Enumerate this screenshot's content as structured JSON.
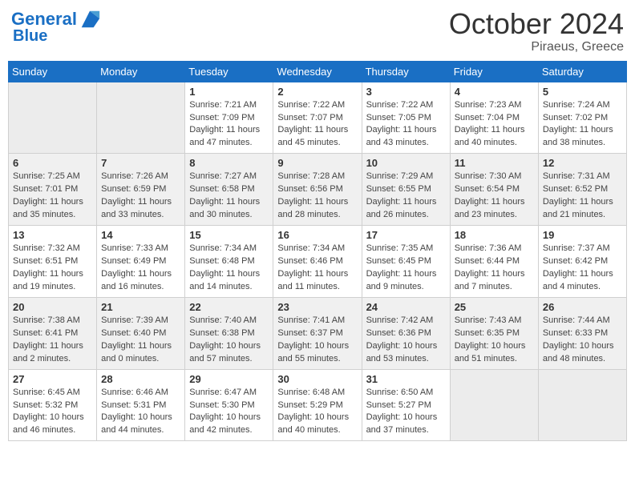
{
  "header": {
    "logo_line1": "General",
    "logo_line2": "Blue",
    "month": "October 2024",
    "location": "Piraeus, Greece"
  },
  "weekdays": [
    "Sunday",
    "Monday",
    "Tuesday",
    "Wednesday",
    "Thursday",
    "Friday",
    "Saturday"
  ],
  "weeks": [
    [
      {
        "day": null
      },
      {
        "day": null
      },
      {
        "day": "1",
        "sunrise": "Sunrise: 7:21 AM",
        "sunset": "Sunset: 7:09 PM",
        "daylight": "Daylight: 11 hours and 47 minutes."
      },
      {
        "day": "2",
        "sunrise": "Sunrise: 7:22 AM",
        "sunset": "Sunset: 7:07 PM",
        "daylight": "Daylight: 11 hours and 45 minutes."
      },
      {
        "day": "3",
        "sunrise": "Sunrise: 7:22 AM",
        "sunset": "Sunset: 7:05 PM",
        "daylight": "Daylight: 11 hours and 43 minutes."
      },
      {
        "day": "4",
        "sunrise": "Sunrise: 7:23 AM",
        "sunset": "Sunset: 7:04 PM",
        "daylight": "Daylight: 11 hours and 40 minutes."
      },
      {
        "day": "5",
        "sunrise": "Sunrise: 7:24 AM",
        "sunset": "Sunset: 7:02 PM",
        "daylight": "Daylight: 11 hours and 38 minutes."
      }
    ],
    [
      {
        "day": "6",
        "sunrise": "Sunrise: 7:25 AM",
        "sunset": "Sunset: 7:01 PM",
        "daylight": "Daylight: 11 hours and 35 minutes."
      },
      {
        "day": "7",
        "sunrise": "Sunrise: 7:26 AM",
        "sunset": "Sunset: 6:59 PM",
        "daylight": "Daylight: 11 hours and 33 minutes."
      },
      {
        "day": "8",
        "sunrise": "Sunrise: 7:27 AM",
        "sunset": "Sunset: 6:58 PM",
        "daylight": "Daylight: 11 hours and 30 minutes."
      },
      {
        "day": "9",
        "sunrise": "Sunrise: 7:28 AM",
        "sunset": "Sunset: 6:56 PM",
        "daylight": "Daylight: 11 hours and 28 minutes."
      },
      {
        "day": "10",
        "sunrise": "Sunrise: 7:29 AM",
        "sunset": "Sunset: 6:55 PM",
        "daylight": "Daylight: 11 hours and 26 minutes."
      },
      {
        "day": "11",
        "sunrise": "Sunrise: 7:30 AM",
        "sunset": "Sunset: 6:54 PM",
        "daylight": "Daylight: 11 hours and 23 minutes."
      },
      {
        "day": "12",
        "sunrise": "Sunrise: 7:31 AM",
        "sunset": "Sunset: 6:52 PM",
        "daylight": "Daylight: 11 hours and 21 minutes."
      }
    ],
    [
      {
        "day": "13",
        "sunrise": "Sunrise: 7:32 AM",
        "sunset": "Sunset: 6:51 PM",
        "daylight": "Daylight: 11 hours and 19 minutes."
      },
      {
        "day": "14",
        "sunrise": "Sunrise: 7:33 AM",
        "sunset": "Sunset: 6:49 PM",
        "daylight": "Daylight: 11 hours and 16 minutes."
      },
      {
        "day": "15",
        "sunrise": "Sunrise: 7:34 AM",
        "sunset": "Sunset: 6:48 PM",
        "daylight": "Daylight: 11 hours and 14 minutes."
      },
      {
        "day": "16",
        "sunrise": "Sunrise: 7:34 AM",
        "sunset": "Sunset: 6:46 PM",
        "daylight": "Daylight: 11 hours and 11 minutes."
      },
      {
        "day": "17",
        "sunrise": "Sunrise: 7:35 AM",
        "sunset": "Sunset: 6:45 PM",
        "daylight": "Daylight: 11 hours and 9 minutes."
      },
      {
        "day": "18",
        "sunrise": "Sunrise: 7:36 AM",
        "sunset": "Sunset: 6:44 PM",
        "daylight": "Daylight: 11 hours and 7 minutes."
      },
      {
        "day": "19",
        "sunrise": "Sunrise: 7:37 AM",
        "sunset": "Sunset: 6:42 PM",
        "daylight": "Daylight: 11 hours and 4 minutes."
      }
    ],
    [
      {
        "day": "20",
        "sunrise": "Sunrise: 7:38 AM",
        "sunset": "Sunset: 6:41 PM",
        "daylight": "Daylight: 11 hours and 2 minutes."
      },
      {
        "day": "21",
        "sunrise": "Sunrise: 7:39 AM",
        "sunset": "Sunset: 6:40 PM",
        "daylight": "Daylight: 11 hours and 0 minutes."
      },
      {
        "day": "22",
        "sunrise": "Sunrise: 7:40 AM",
        "sunset": "Sunset: 6:38 PM",
        "daylight": "Daylight: 10 hours and 57 minutes."
      },
      {
        "day": "23",
        "sunrise": "Sunrise: 7:41 AM",
        "sunset": "Sunset: 6:37 PM",
        "daylight": "Daylight: 10 hours and 55 minutes."
      },
      {
        "day": "24",
        "sunrise": "Sunrise: 7:42 AM",
        "sunset": "Sunset: 6:36 PM",
        "daylight": "Daylight: 10 hours and 53 minutes."
      },
      {
        "day": "25",
        "sunrise": "Sunrise: 7:43 AM",
        "sunset": "Sunset: 6:35 PM",
        "daylight": "Daylight: 10 hours and 51 minutes."
      },
      {
        "day": "26",
        "sunrise": "Sunrise: 7:44 AM",
        "sunset": "Sunset: 6:33 PM",
        "daylight": "Daylight: 10 hours and 48 minutes."
      }
    ],
    [
      {
        "day": "27",
        "sunrise": "Sunrise: 6:45 AM",
        "sunset": "Sunset: 5:32 PM",
        "daylight": "Daylight: 10 hours and 46 minutes."
      },
      {
        "day": "28",
        "sunrise": "Sunrise: 6:46 AM",
        "sunset": "Sunset: 5:31 PM",
        "daylight": "Daylight: 10 hours and 44 minutes."
      },
      {
        "day": "29",
        "sunrise": "Sunrise: 6:47 AM",
        "sunset": "Sunset: 5:30 PM",
        "daylight": "Daylight: 10 hours and 42 minutes."
      },
      {
        "day": "30",
        "sunrise": "Sunrise: 6:48 AM",
        "sunset": "Sunset: 5:29 PM",
        "daylight": "Daylight: 10 hours and 40 minutes."
      },
      {
        "day": "31",
        "sunrise": "Sunrise: 6:50 AM",
        "sunset": "Sunset: 5:27 PM",
        "daylight": "Daylight: 10 hours and 37 minutes."
      },
      {
        "day": null
      },
      {
        "day": null
      }
    ]
  ]
}
